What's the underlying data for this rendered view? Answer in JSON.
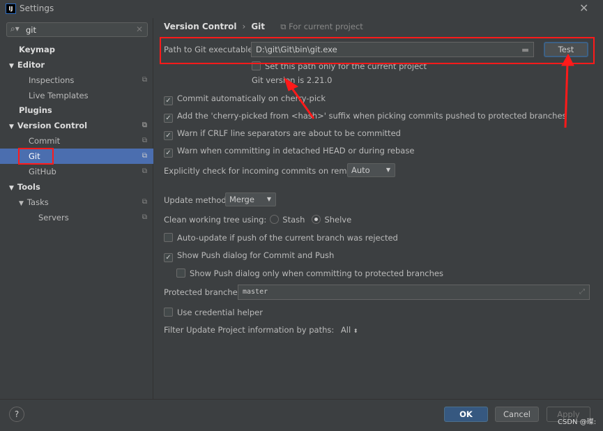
{
  "window": {
    "title": "Settings",
    "app_icon": "IJ"
  },
  "search": {
    "value": "git"
  },
  "sidebar": {
    "items": [
      {
        "label": "Keymap"
      },
      {
        "label": "Editor"
      },
      {
        "label": "Inspections"
      },
      {
        "label": "Live Templates"
      },
      {
        "label": "Plugins"
      },
      {
        "label": "Version Control"
      },
      {
        "label": "Commit"
      },
      {
        "label": "Git"
      },
      {
        "label": "GitHub"
      },
      {
        "label": "Tools"
      },
      {
        "label": "Tasks"
      },
      {
        "label": "Servers"
      }
    ]
  },
  "breadcrumb": {
    "parent": "Version Control",
    "current": "Git",
    "scope": "For current project"
  },
  "git": {
    "path_label": "Path to Git executable:",
    "path_value": "D:\\git\\Git\\bin\\git.exe",
    "test_label": "Test",
    "project_only_label": "Set this path only for the current project",
    "version_text": "Git version is 2.21.0",
    "commit_auto": "Commit automatically on cherry-pick",
    "cherry_suffix": "Add the 'cherry-picked from <hash>' suffix when picking commits pushed to protected branches",
    "crlf": "Warn if CRLF line separators are about to be committed",
    "detached": "Warn when committing in detached HEAD or during rebase",
    "incoming_label": "Explicitly check for incoming commits on remotes:",
    "incoming_value": "Auto",
    "update_label": "Update method:",
    "update_value": "Merge",
    "clean_label": "Clean working tree using:",
    "stash": "Stash",
    "shelve": "Shelve",
    "autoupdate": "Auto-update if push of the current branch was rejected",
    "show_push": "Show Push dialog for Commit and Push",
    "show_push_protected": "Show Push dialog only when committing to protected branches",
    "protected_label": "Protected branches:",
    "protected_value": "master",
    "credential": "Use credential helper",
    "filter_label": "Filter Update Project information by paths:",
    "filter_value": "All"
  },
  "footer": {
    "ok": "OK",
    "cancel": "Cancel",
    "apply": "Apply",
    "help": "?"
  },
  "watermark": "CSDN @璨:",
  "annotation_color": "#ff1a1a"
}
